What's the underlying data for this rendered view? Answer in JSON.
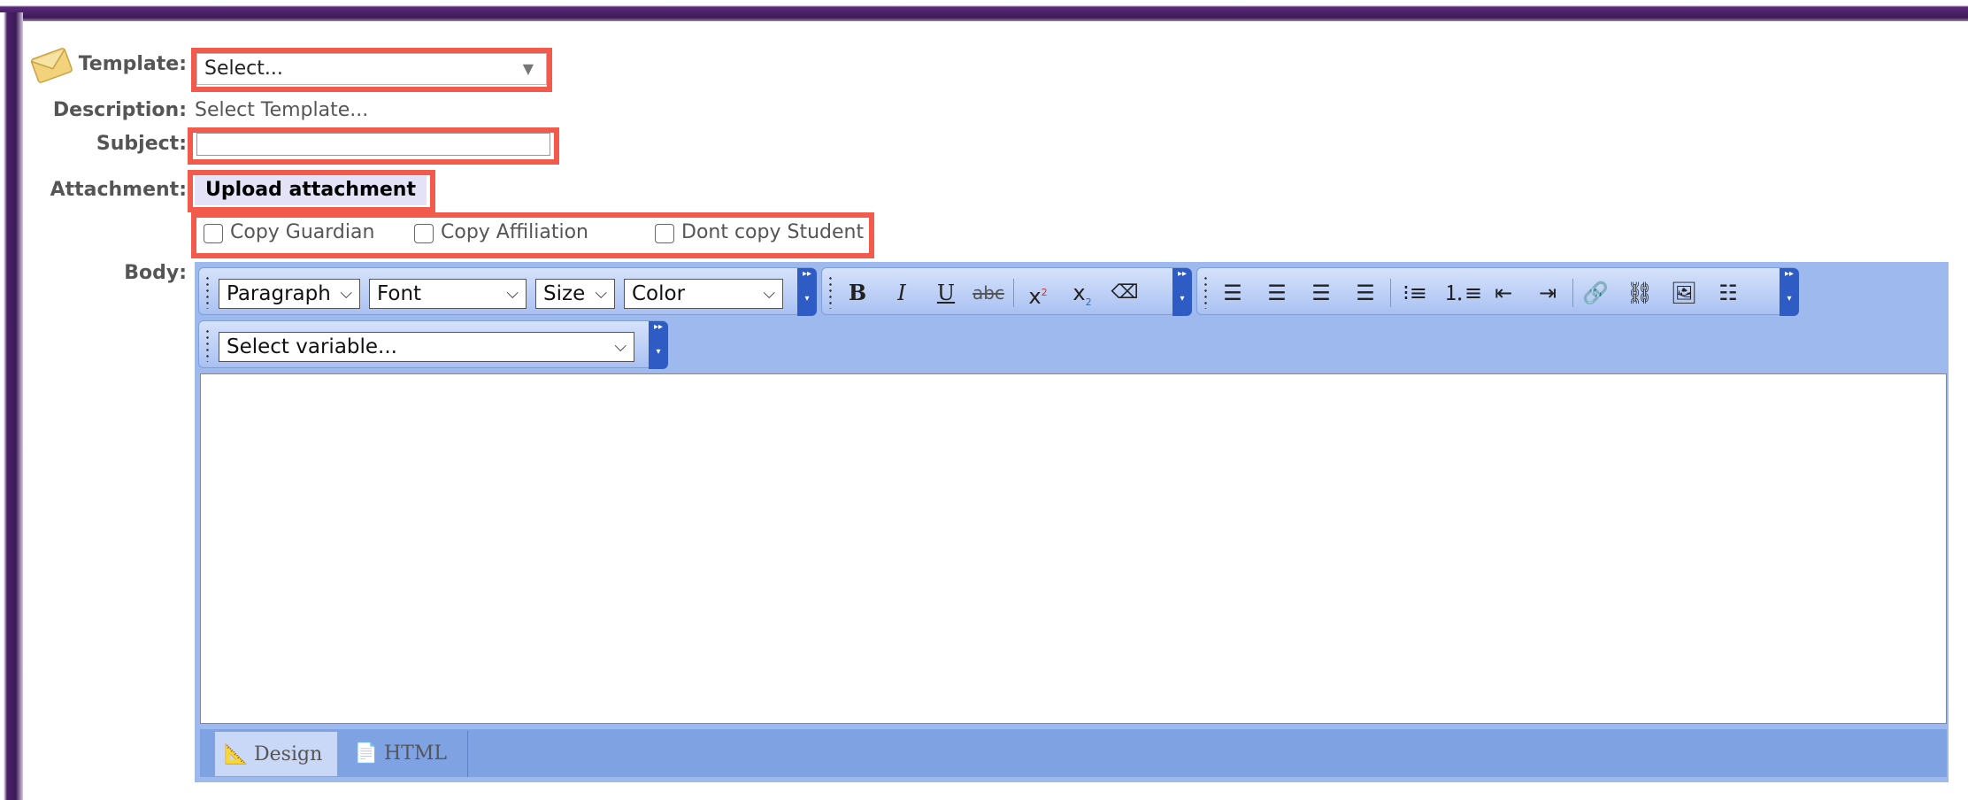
{
  "form": {
    "template_label": "Template:",
    "template_value": "Select...",
    "description_label": "Description:",
    "description_value": "Select Template...",
    "subject_label": "Subject:",
    "subject_value": "",
    "attachment_label": "Attachment:",
    "upload_button": "Upload attachment",
    "copy_options": [
      {
        "label": "Copy Guardian",
        "checked": false
      },
      {
        "label": "Copy Affiliation",
        "checked": false
      },
      {
        "label": "Dont copy Student",
        "checked": false
      }
    ],
    "body_label": "Body:"
  },
  "editor": {
    "format_dropdowns": [
      "Paragraph",
      "Font",
      "Size",
      "Color"
    ],
    "variable_dropdown": "Select variable...",
    "text_tools": [
      "bold-icon",
      "italic-icon",
      "underline-icon",
      "strikethrough-icon",
      "superscript-icon",
      "subscript-icon",
      "eraser-icon"
    ],
    "align_tools": [
      "align-left-icon",
      "align-right-icon",
      "align-center-icon",
      "justify-icon",
      "bullet-list-icon",
      "numbered-list-icon",
      "outdent-icon",
      "indent-icon",
      "insert-link-icon",
      "unlink-icon",
      "insert-image-icon",
      "horizontal-rule-icon"
    ],
    "tabs": [
      {
        "label": "Design",
        "active": true
      },
      {
        "label": "HTML",
        "active": false
      }
    ]
  },
  "colors": {
    "highlight": "#f25a4b",
    "editor_bg": "#9eb9ee",
    "frame": "#3b1b55"
  }
}
